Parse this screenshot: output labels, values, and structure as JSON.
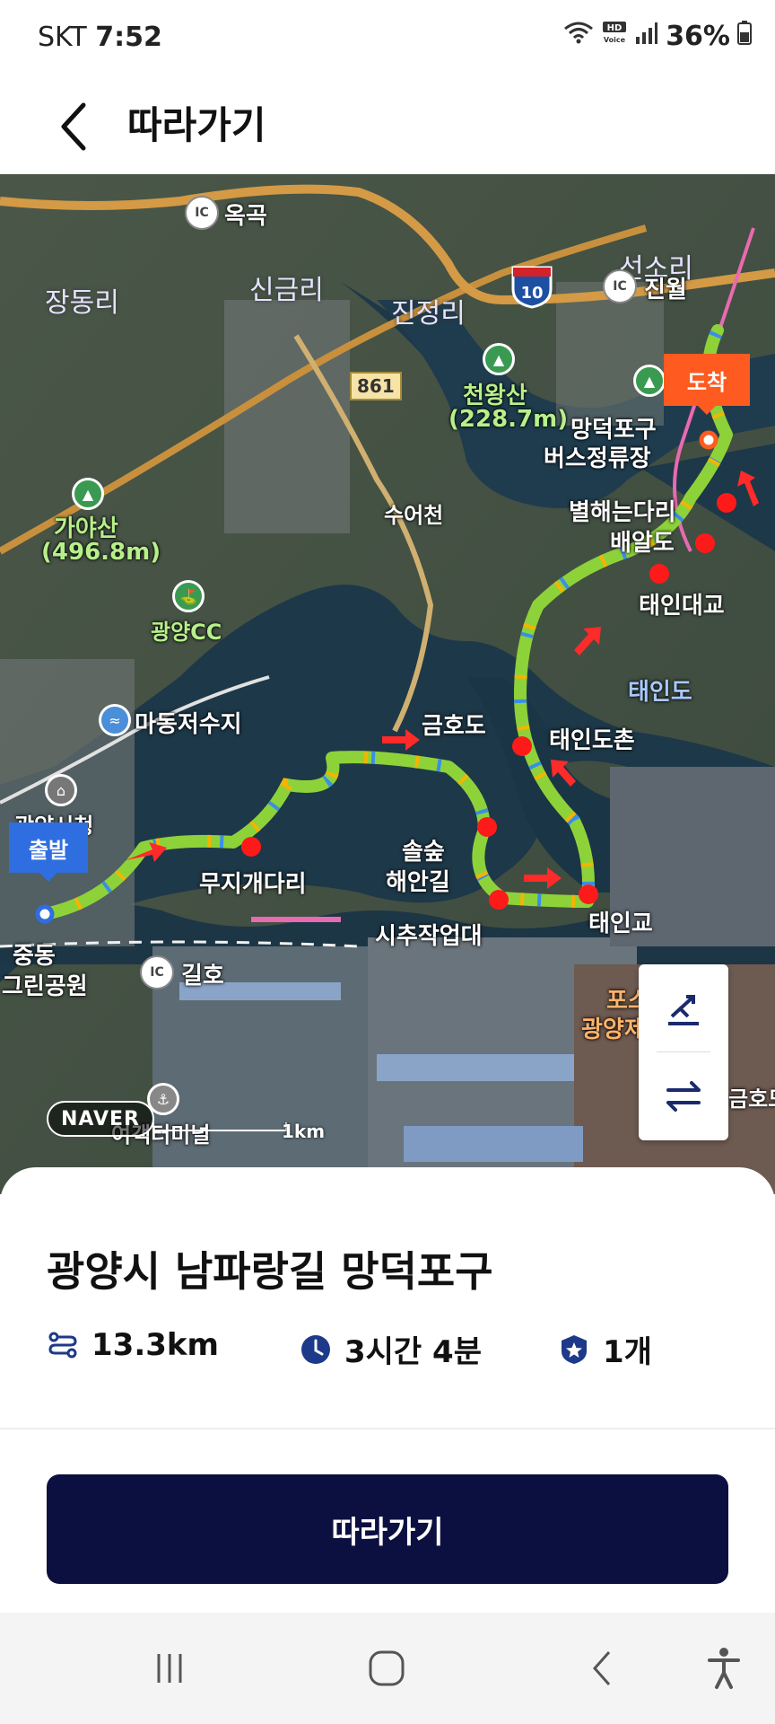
{
  "status_bar": {
    "carrier": "SKT",
    "time": "7:52",
    "battery": "36%"
  },
  "header": {
    "title": "따라가기"
  },
  "map": {
    "start_label": "출발",
    "end_label": "도착",
    "place_labels": {
      "okgok": "옥곡",
      "seonsuri": "선소리",
      "jinwol": "진월",
      "jangdongri": "장동리",
      "singeumri": "신금리",
      "jinjeongri": "진정리",
      "road_861": "861",
      "highway_10": "10",
      "cheonwangsan": "천왕산",
      "cheonwangsan_height": "(228.7m)",
      "mangdeok_stop_1": "망덕포구",
      "mangdeok_stop_2": "버스정류장",
      "gayasan": "가야산",
      "gayasan_height": "(496.8m)",
      "sueocheon": "수어천",
      "byeolhae_bridge": "별해는다리",
      "baealdo": "배알도",
      "gwangyang_cc": "광양CC",
      "taein_bridge_big": "태인대교",
      "taeindo": "태인도",
      "madong_reservoir": "마동저수지",
      "geumhodo": "금호도",
      "taeindochon": "태인도촌",
      "gwangyang_city_hall": "광양시청",
      "solsup_1": "솔숲",
      "solsup_2": "해안길",
      "mujigae_bridge": "무지개다리",
      "taeingyo": "태인교",
      "sichuk": "시추작업대",
      "jungdong": "중동",
      "green_park": "그린공원",
      "gilho": "길호",
      "posco_1": "포스",
      "posco_2": "광양제",
      "ferry_terminal": "여객터미널",
      "geumhodo_edge": "금호도"
    },
    "naver_logo": "NAVER",
    "scale_label": "1km",
    "colors": {
      "route": "#8ed23a",
      "checkpoint": "#ff1a1a",
      "start_badge": "#2f6ee0",
      "end_badge": "#ff5a1f"
    },
    "controls": [
      "route-fit-icon",
      "swap-direction-icon"
    ]
  },
  "route": {
    "title": "광양시 남파랑길 망덕포구",
    "distance": "13.3km",
    "duration": "3시간 4분",
    "stamps": "1개"
  },
  "actions": {
    "follow_label": "따라가기"
  },
  "nav_bar": {
    "icons": [
      "recent-apps-icon",
      "home-icon",
      "back-icon",
      "accessibility-icon"
    ]
  }
}
